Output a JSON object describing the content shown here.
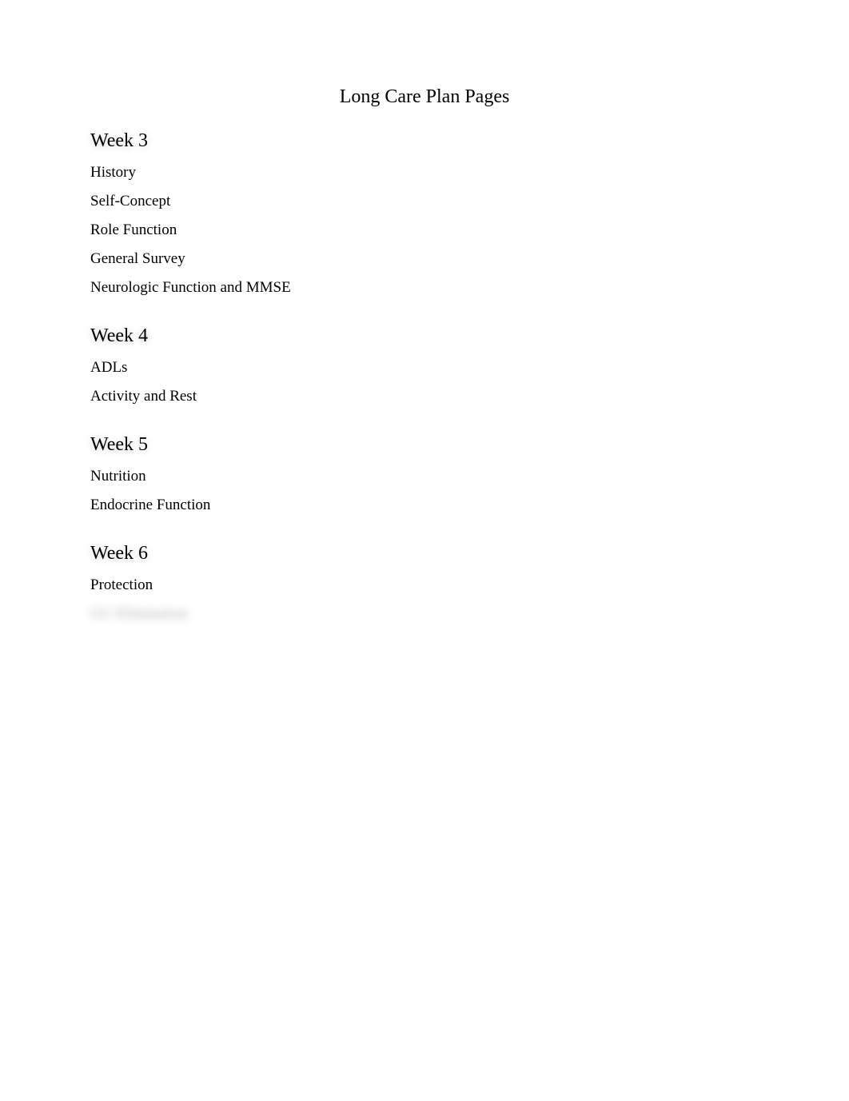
{
  "title": "Long Care Plan Pages",
  "sections": [
    {
      "heading": "Week 3",
      "items": [
        {
          "label": "History",
          "blurred": false
        },
        {
          "label": "Self-Concept",
          "blurred": false
        },
        {
          "label": "Role Function",
          "blurred": false
        },
        {
          "label": "General Survey",
          "blurred": false
        },
        {
          "label": "Neurologic Function and MMSE",
          "blurred": false
        }
      ]
    },
    {
      "heading": "Week 4",
      "items": [
        {
          "label": "ADLs",
          "blurred": false
        },
        {
          "label": "Activity and Rest",
          "blurred": false
        }
      ]
    },
    {
      "heading": "Week 5",
      "items": [
        {
          "label": "Nutrition",
          "blurred": false
        },
        {
          "label": "Endocrine Function",
          "blurred": false
        }
      ]
    },
    {
      "heading": "Week 6",
      "items": [
        {
          "label": "Protection",
          "blurred": false
        },
        {
          "label": "GU Elimination",
          "blurred": true
        }
      ]
    }
  ]
}
